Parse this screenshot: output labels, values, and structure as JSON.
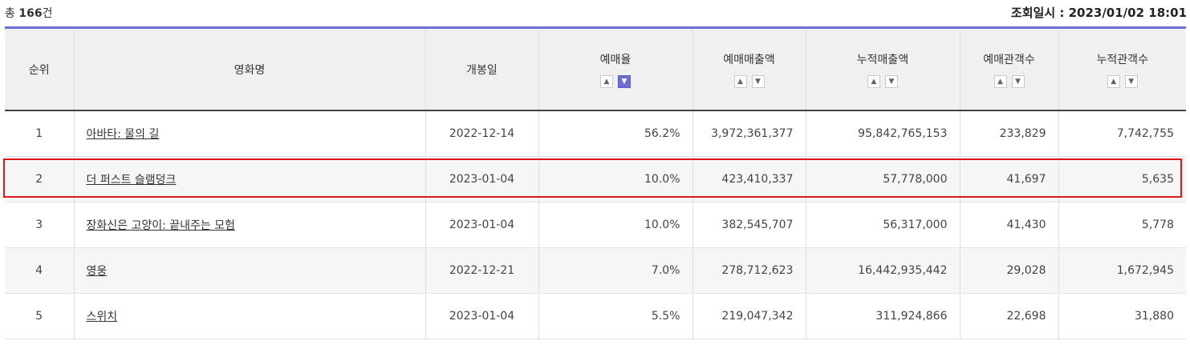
{
  "summary": {
    "total_prefix": "총 ",
    "total_count": "166",
    "total_suffix": "건"
  },
  "timestamp": {
    "label": "조회일시 : ",
    "value": "2023/01/02 18:01"
  },
  "headers": {
    "rank": "순위",
    "title": "영화명",
    "release": "개봉일",
    "reserve_rate": "예매율",
    "reserve_sales": "예매매출액",
    "total_sales": "누적매출액",
    "reserve_audience": "예매관객수",
    "total_audience": "누적관객수"
  },
  "sort_icons": {
    "up": "chevron-up-icon",
    "down": "chevron-down-icon"
  },
  "accent_color": "#6b6fd4",
  "highlight_color": "#e0151b",
  "rows": [
    {
      "rank": "1",
      "title": "아바타: 물의 길",
      "release": "2022-12-14",
      "reserve_rate": "56.2%",
      "reserve_sales": "3,972,361,377",
      "total_sales": "95,842,765,153",
      "reserve_audience": "233,829",
      "total_audience": "7,742,755"
    },
    {
      "rank": "2",
      "title": "더 퍼스트 슬램덩크",
      "release": "2023-01-04",
      "reserve_rate": "10.0%",
      "reserve_sales": "423,410,337",
      "total_sales": "57,778,000",
      "reserve_audience": "41,697",
      "total_audience": "5,635"
    },
    {
      "rank": "3",
      "title": "장화신은 고양이: 끝내주는 모험",
      "release": "2023-01-04",
      "reserve_rate": "10.0%",
      "reserve_sales": "382,545,707",
      "total_sales": "56,317,000",
      "reserve_audience": "41,430",
      "total_audience": "5,778"
    },
    {
      "rank": "4",
      "title": "영웅",
      "release": "2022-12-21",
      "reserve_rate": "7.0%",
      "reserve_sales": "278,712,623",
      "total_sales": "16,442,935,442",
      "reserve_audience": "29,028",
      "total_audience": "1,672,945"
    },
    {
      "rank": "5",
      "title": "스위치",
      "release": "2023-01-04",
      "reserve_rate": "5.5%",
      "reserve_sales": "219,047,342",
      "total_sales": "311,924,866",
      "reserve_audience": "22,698",
      "total_audience": "31,880"
    }
  ]
}
